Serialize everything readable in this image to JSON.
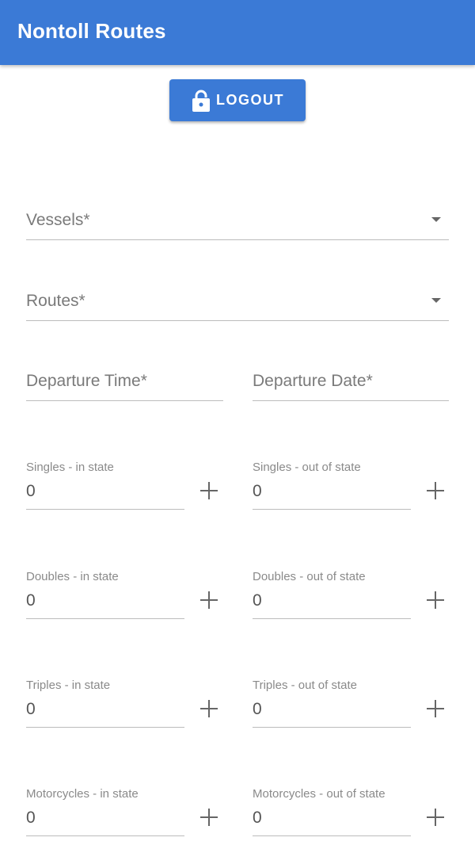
{
  "app": {
    "title": "Nontoll Routes"
  },
  "logout": {
    "label": "LOGOUT"
  },
  "form": {
    "vessels_label": "Vessels*",
    "routes_label": "Routes*",
    "departure_time_label": "Departure Time*",
    "departure_date_label": "Departure Date*",
    "counters": [
      {
        "label": "Singles - in state",
        "value": "0"
      },
      {
        "label": "Singles - out of state",
        "value": "0"
      },
      {
        "label": "Doubles - in state",
        "value": "0"
      },
      {
        "label": "Doubles - out of state",
        "value": "0"
      },
      {
        "label": "Triples - in state",
        "value": "0"
      },
      {
        "label": "Triples - out of state",
        "value": "0"
      },
      {
        "label": "Motorcycles - in state",
        "value": "0"
      },
      {
        "label": "Motorcycles - out of state",
        "value": "0"
      }
    ]
  },
  "colors": {
    "primary": "#3b7ad6"
  }
}
